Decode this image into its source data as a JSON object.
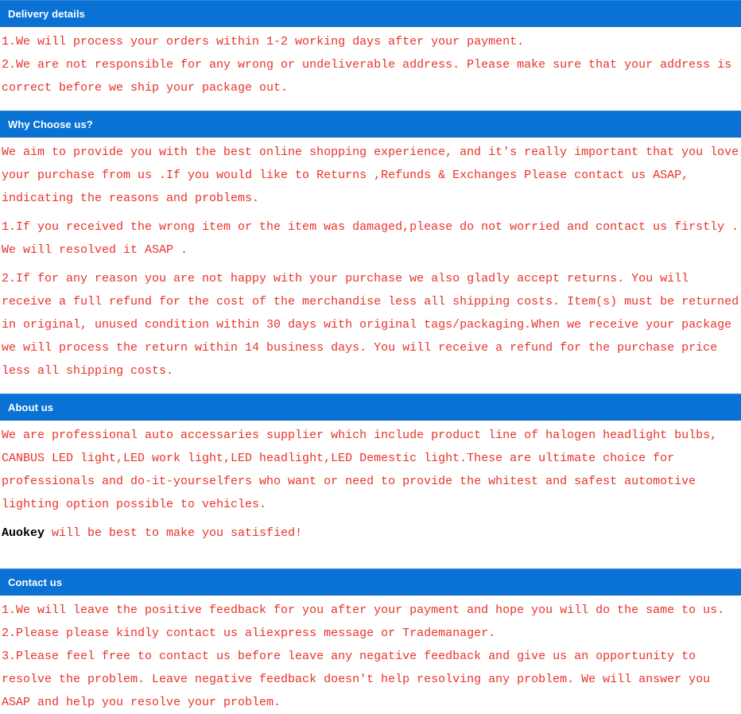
{
  "colors": {
    "header_bar": "#0a72d4",
    "header_text": "#ffffff",
    "body_text": "#e8332a",
    "brand_text": "#000000",
    "page_background": "#ffffff"
  },
  "sections": [
    {
      "id": "delivery-details",
      "title": "Delivery details",
      "paragraphs": [
        "1.We will process your orders within 1-2 working days after your payment.",
        "2.We are not responsible for any wrong or undeliverable address. Please make sure that your address is correct before we ship your package out."
      ]
    },
    {
      "id": "why-choose-us",
      "title": "Why Choose us?",
      "paragraphs": [
        "We aim to provide you with the best online shopping experience, and it's really important that you love your purchase from us .If you would like to Returns ,Refunds & Exchanges Please contact us ASAP, indicating the reasons and problems.",
        "1.If you received the wrong item or the item was damaged,please do not worried and contact us firstly . We will resolved it ASAP .",
        "2.If for any reason you are not happy with your purchase we also gladly accept returns. You will receive a full refund for the cost of the merchandise less all shipping costs. Item(s) must be returned in original, unused condition within 30 days with original tags/packaging.When we receive your package we will process the return within 14 business days. You will receive a refund for the purchase price less all shipping costs."
      ]
    },
    {
      "id": "about-us",
      "title": "About us",
      "paragraphs": [
        "We are professional auto accessaries supplier which include product line of halogen headlight bulbs, CANBUS LED light,LED work light,LED headlight,LED Demestic light.These are ultimate choice for professionals and do-it-yourselfers who want or need to provide the whitest and safest automotive lighting option possible to vehicles."
      ],
      "tagline": {
        "brand": "Auokey",
        "rest": " will be best to make you satisfied!"
      }
    },
    {
      "id": "contact-us",
      "title": "Contact us",
      "paragraphs": [
        "1.We will leave the positive feedback for you after your payment and hope you will do the same to us.",
        "2.Please please kindly contact us aliexpress message or Trademanager.",
        "3.Please feel free to contact us before leave any negative feedback and give us an opportunity to resolve the problem. Leave negative feedback doesn′t help resolving any problem. We will answer you ASAP and help you resolve your problem."
      ]
    }
  ]
}
